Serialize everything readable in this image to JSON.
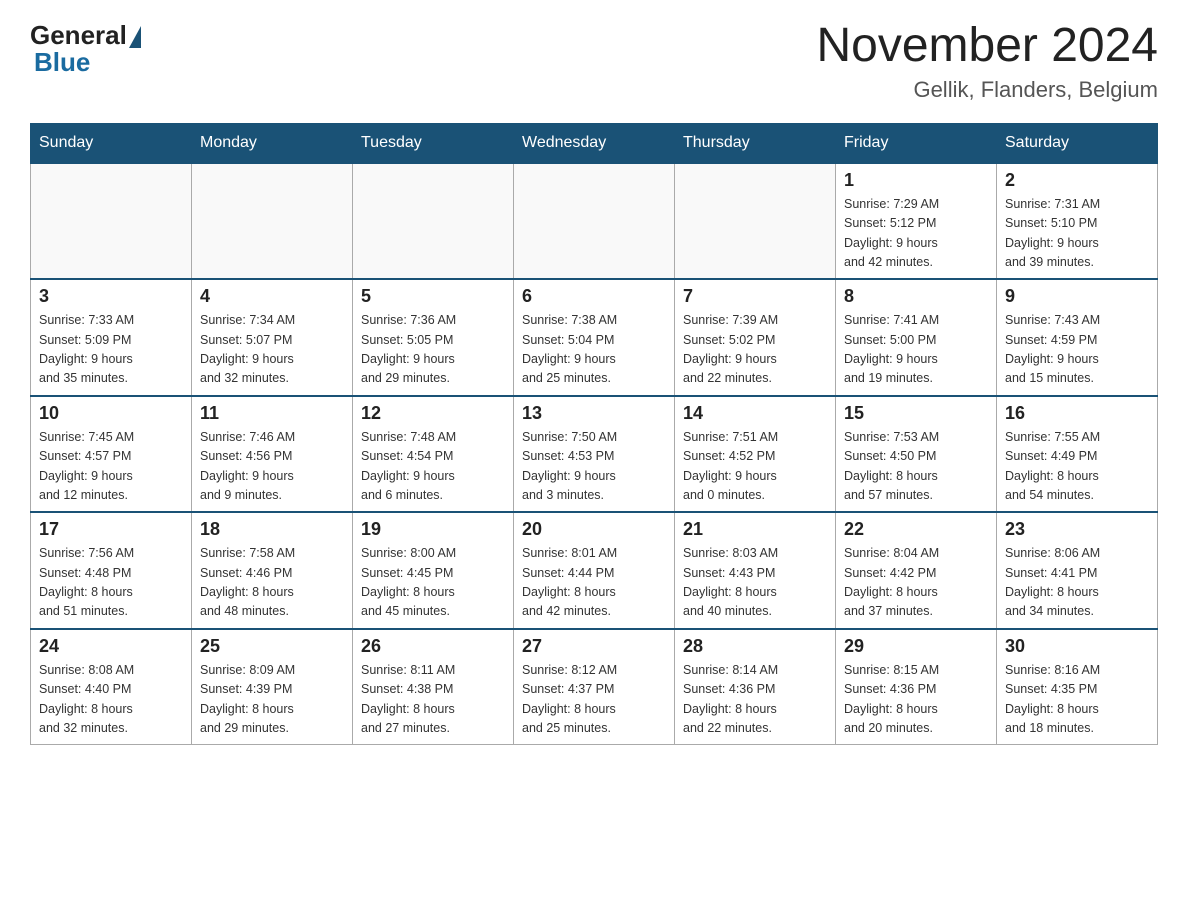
{
  "logo": {
    "general": "General",
    "blue": "Blue"
  },
  "header": {
    "month_year": "November 2024",
    "location": "Gellik, Flanders, Belgium"
  },
  "days_of_week": [
    "Sunday",
    "Monday",
    "Tuesday",
    "Wednesday",
    "Thursday",
    "Friday",
    "Saturday"
  ],
  "weeks": [
    [
      {
        "day": "",
        "info": ""
      },
      {
        "day": "",
        "info": ""
      },
      {
        "day": "",
        "info": ""
      },
      {
        "day": "",
        "info": ""
      },
      {
        "day": "",
        "info": ""
      },
      {
        "day": "1",
        "info": "Sunrise: 7:29 AM\nSunset: 5:12 PM\nDaylight: 9 hours\nand 42 minutes."
      },
      {
        "day": "2",
        "info": "Sunrise: 7:31 AM\nSunset: 5:10 PM\nDaylight: 9 hours\nand 39 minutes."
      }
    ],
    [
      {
        "day": "3",
        "info": "Sunrise: 7:33 AM\nSunset: 5:09 PM\nDaylight: 9 hours\nand 35 minutes."
      },
      {
        "day": "4",
        "info": "Sunrise: 7:34 AM\nSunset: 5:07 PM\nDaylight: 9 hours\nand 32 minutes."
      },
      {
        "day": "5",
        "info": "Sunrise: 7:36 AM\nSunset: 5:05 PM\nDaylight: 9 hours\nand 29 minutes."
      },
      {
        "day": "6",
        "info": "Sunrise: 7:38 AM\nSunset: 5:04 PM\nDaylight: 9 hours\nand 25 minutes."
      },
      {
        "day": "7",
        "info": "Sunrise: 7:39 AM\nSunset: 5:02 PM\nDaylight: 9 hours\nand 22 minutes."
      },
      {
        "day": "8",
        "info": "Sunrise: 7:41 AM\nSunset: 5:00 PM\nDaylight: 9 hours\nand 19 minutes."
      },
      {
        "day": "9",
        "info": "Sunrise: 7:43 AM\nSunset: 4:59 PM\nDaylight: 9 hours\nand 15 minutes."
      }
    ],
    [
      {
        "day": "10",
        "info": "Sunrise: 7:45 AM\nSunset: 4:57 PM\nDaylight: 9 hours\nand 12 minutes."
      },
      {
        "day": "11",
        "info": "Sunrise: 7:46 AM\nSunset: 4:56 PM\nDaylight: 9 hours\nand 9 minutes."
      },
      {
        "day": "12",
        "info": "Sunrise: 7:48 AM\nSunset: 4:54 PM\nDaylight: 9 hours\nand 6 minutes."
      },
      {
        "day": "13",
        "info": "Sunrise: 7:50 AM\nSunset: 4:53 PM\nDaylight: 9 hours\nand 3 minutes."
      },
      {
        "day": "14",
        "info": "Sunrise: 7:51 AM\nSunset: 4:52 PM\nDaylight: 9 hours\nand 0 minutes."
      },
      {
        "day": "15",
        "info": "Sunrise: 7:53 AM\nSunset: 4:50 PM\nDaylight: 8 hours\nand 57 minutes."
      },
      {
        "day": "16",
        "info": "Sunrise: 7:55 AM\nSunset: 4:49 PM\nDaylight: 8 hours\nand 54 minutes."
      }
    ],
    [
      {
        "day": "17",
        "info": "Sunrise: 7:56 AM\nSunset: 4:48 PM\nDaylight: 8 hours\nand 51 minutes."
      },
      {
        "day": "18",
        "info": "Sunrise: 7:58 AM\nSunset: 4:46 PM\nDaylight: 8 hours\nand 48 minutes."
      },
      {
        "day": "19",
        "info": "Sunrise: 8:00 AM\nSunset: 4:45 PM\nDaylight: 8 hours\nand 45 minutes."
      },
      {
        "day": "20",
        "info": "Sunrise: 8:01 AM\nSunset: 4:44 PM\nDaylight: 8 hours\nand 42 minutes."
      },
      {
        "day": "21",
        "info": "Sunrise: 8:03 AM\nSunset: 4:43 PM\nDaylight: 8 hours\nand 40 minutes."
      },
      {
        "day": "22",
        "info": "Sunrise: 8:04 AM\nSunset: 4:42 PM\nDaylight: 8 hours\nand 37 minutes."
      },
      {
        "day": "23",
        "info": "Sunrise: 8:06 AM\nSunset: 4:41 PM\nDaylight: 8 hours\nand 34 minutes."
      }
    ],
    [
      {
        "day": "24",
        "info": "Sunrise: 8:08 AM\nSunset: 4:40 PM\nDaylight: 8 hours\nand 32 minutes."
      },
      {
        "day": "25",
        "info": "Sunrise: 8:09 AM\nSunset: 4:39 PM\nDaylight: 8 hours\nand 29 minutes."
      },
      {
        "day": "26",
        "info": "Sunrise: 8:11 AM\nSunset: 4:38 PM\nDaylight: 8 hours\nand 27 minutes."
      },
      {
        "day": "27",
        "info": "Sunrise: 8:12 AM\nSunset: 4:37 PM\nDaylight: 8 hours\nand 25 minutes."
      },
      {
        "day": "28",
        "info": "Sunrise: 8:14 AM\nSunset: 4:36 PM\nDaylight: 8 hours\nand 22 minutes."
      },
      {
        "day": "29",
        "info": "Sunrise: 8:15 AM\nSunset: 4:36 PM\nDaylight: 8 hours\nand 20 minutes."
      },
      {
        "day": "30",
        "info": "Sunrise: 8:16 AM\nSunset: 4:35 PM\nDaylight: 8 hours\nand 18 minutes."
      }
    ]
  ]
}
